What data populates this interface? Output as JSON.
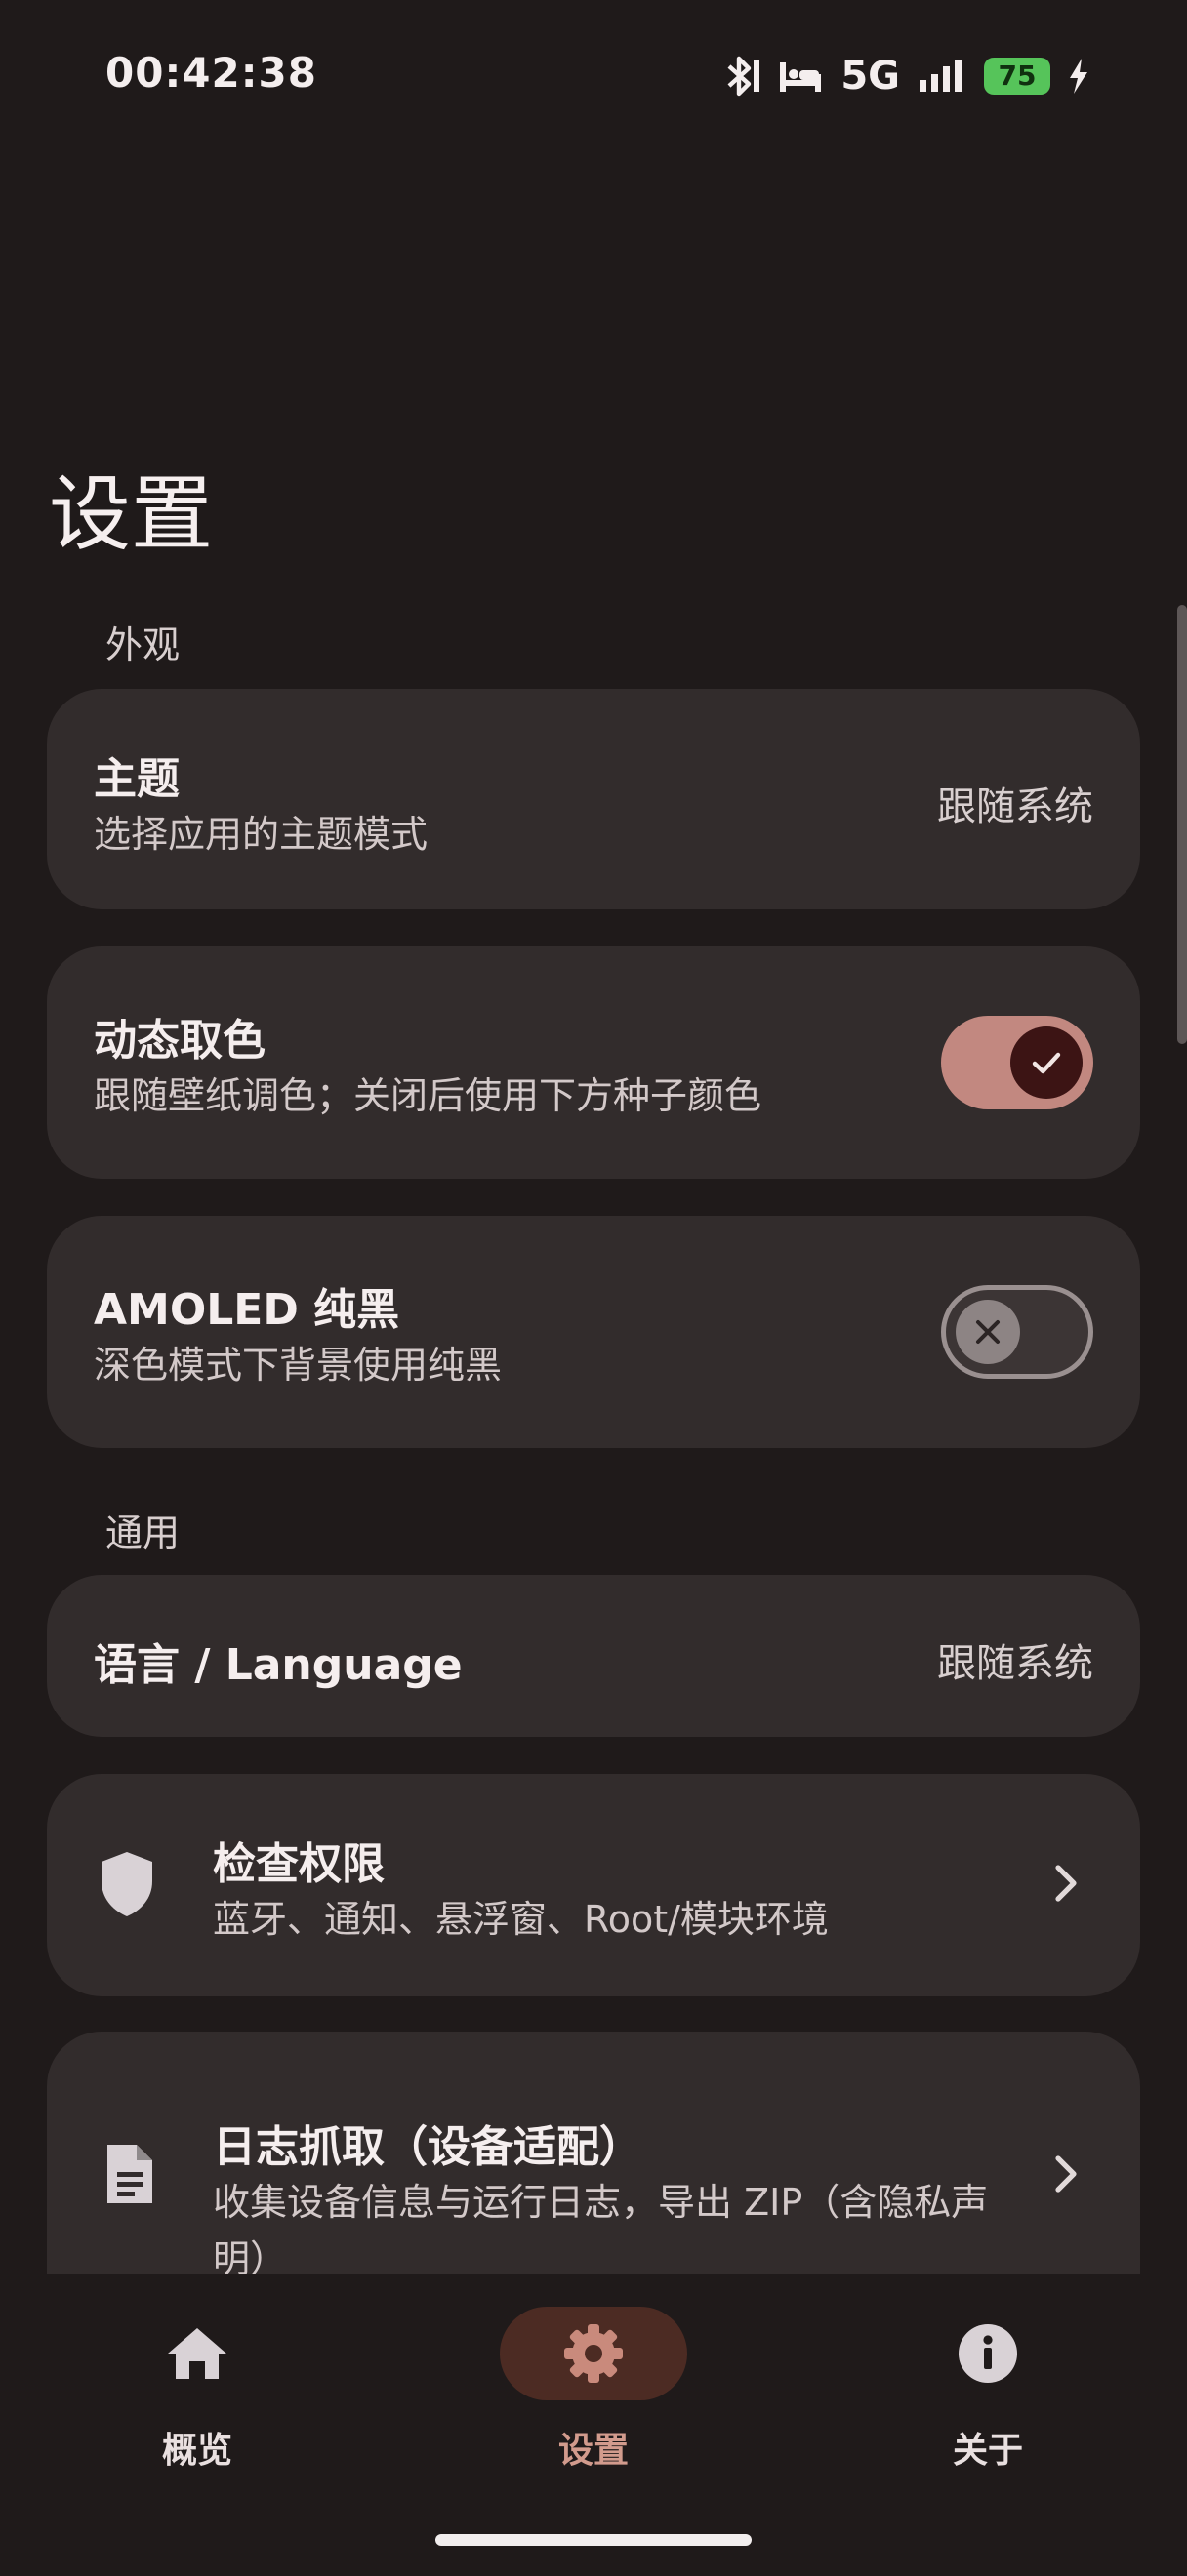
{
  "status_bar": {
    "time": "00:42:38",
    "network": "5G",
    "battery_level": "75",
    "icons": [
      "bluetooth-icon",
      "bed-icon",
      "signal-icon",
      "charging-icon"
    ]
  },
  "page": {
    "title": "设置"
  },
  "sections": {
    "appearance": "外观",
    "general": "通用"
  },
  "settings": {
    "theme": {
      "title": "主题",
      "subtitle": "选择应用的主题模式",
      "value": "跟随系统"
    },
    "dynamic_color": {
      "title": "动态取色",
      "subtitle": "跟随壁纸调色；关闭后使用下方种子颜色",
      "enabled": true
    },
    "amoled": {
      "title": "AMOLED 纯黑",
      "subtitle": "深色模式下背景使用纯黑",
      "enabled": false
    },
    "language": {
      "title": "语言 / Language",
      "value": "跟随系统"
    },
    "permissions": {
      "title": "检查权限",
      "subtitle": "蓝牙、通知、悬浮窗、Root/模块环境",
      "icon": "shield-icon"
    },
    "log_capture": {
      "title": "日志抓取（设备适配）",
      "subtitle": "收集设备信息与运行日志，导出 ZIP（含隐私声明）",
      "icon": "document-icon"
    }
  },
  "bottom_nav": {
    "items": [
      {
        "label": "概览",
        "icon": "home-icon",
        "active": false
      },
      {
        "label": "设置",
        "icon": "gear-icon",
        "active": true
      },
      {
        "label": "关于",
        "icon": "info-icon",
        "active": false
      }
    ]
  },
  "colors": {
    "background": "#1f1a1a",
    "card": "#322c2c",
    "accent": "#c28880",
    "nav_active_pill": "#4c2b23",
    "nav_active_label": "#d29b8d",
    "battery": "#56c45a"
  }
}
